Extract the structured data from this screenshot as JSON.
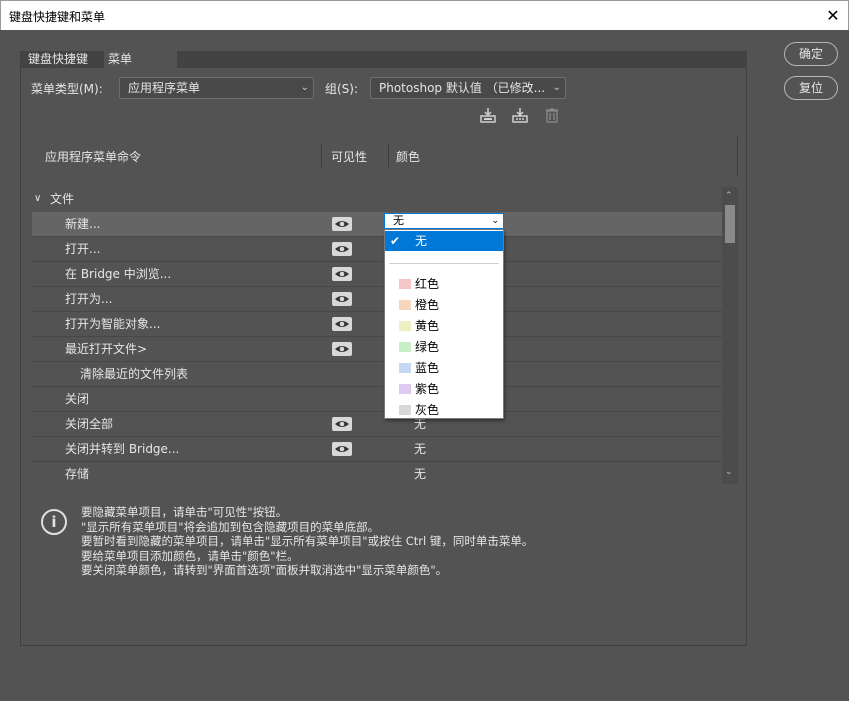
{
  "window": {
    "title": "键盘快捷键和菜单",
    "close_glyph": "✕"
  },
  "tabs": [
    {
      "label": "键盘快捷键"
    },
    {
      "label": "菜单"
    }
  ],
  "controls": {
    "menu_type_label": "菜单类型(M):",
    "menu_type_value": "应用程序菜单",
    "group_label": "组(S):",
    "group_value": "Photoshop 默认值 （已修改..."
  },
  "buttons": {
    "ok": "确定",
    "reset": "复位"
  },
  "columns": {
    "command": "应用程序菜单命令",
    "visibility": "可见性",
    "color": "颜色"
  },
  "group_row": {
    "expander": "∨",
    "label": "文件"
  },
  "rows": [
    {
      "name": "新建...",
      "eye": true,
      "color": ""
    },
    {
      "name": "打开...",
      "eye": true,
      "color": ""
    },
    {
      "name": "在 Bridge 中浏览...",
      "eye": true,
      "color": ""
    },
    {
      "name": "打开为...",
      "eye": true,
      "color": ""
    },
    {
      "name": "打开为智能对象...",
      "eye": true,
      "color": ""
    },
    {
      "name": "最近打开文件>",
      "eye": true,
      "color": ""
    },
    {
      "name": "清除最近的文件列表",
      "eye": false,
      "color": ""
    },
    {
      "name": "关闭",
      "eye": false,
      "color": ""
    },
    {
      "name": "关闭全部",
      "eye": true,
      "color": "无"
    },
    {
      "name": "关闭并转到 Bridge...",
      "eye": true,
      "color": "无"
    },
    {
      "name": "存储",
      "eye": false,
      "color": "无"
    }
  ],
  "color_select": {
    "value": "无"
  },
  "dropdown": {
    "selected": {
      "label": "无",
      "check": "✔"
    },
    "options": [
      {
        "label": "红色",
        "swatch": "#f4c6c6"
      },
      {
        "label": "橙色",
        "swatch": "#f6d7be"
      },
      {
        "label": "黄色",
        "swatch": "#eef0c4"
      },
      {
        "label": "绿色",
        "swatch": "#c8eec8"
      },
      {
        "label": "蓝色",
        "swatch": "#c6d8f2"
      },
      {
        "label": "紫色",
        "swatch": "#dccaf0"
      },
      {
        "label": "灰色",
        "swatch": "#d8d8d8"
      }
    ]
  },
  "info": {
    "icon": "i",
    "lines": [
      "要隐藏菜单项目，请单击\"可见性\"按钮。",
      "\"显示所有菜单项目\"将会追加到包含隐藏项目的菜单底部。",
      "要暂时看到隐藏的菜单项目，请单击\"显示所有菜单项目\"或按住 Ctrl 键，同时单击菜单。",
      "要给菜单项目添加颜色，请单击\"颜色\"栏。",
      "要关闭菜单颜色，请转到\"界面首选项\"面板并取消选中\"显示菜单颜色\"。"
    ]
  }
}
